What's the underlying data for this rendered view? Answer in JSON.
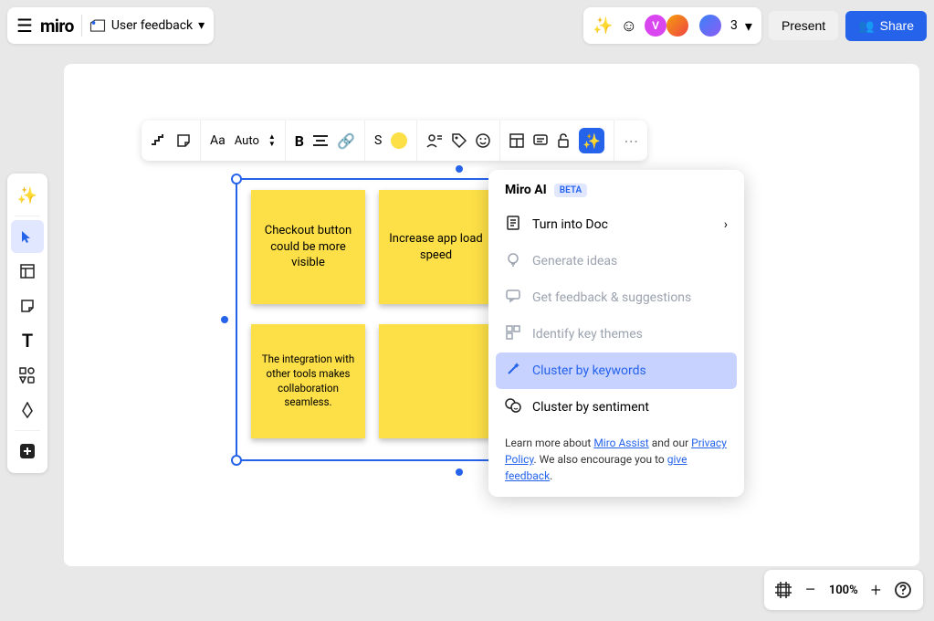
{
  "header": {
    "logo": "miro",
    "board_name": "User feedback",
    "user_count": "3",
    "present_label": "Present",
    "share_label": "Share",
    "avatar_letter": "V"
  },
  "context_toolbar": {
    "auto_label": "Auto",
    "size_label": "S",
    "font_label": "Aa"
  },
  "stickies": [
    {
      "text": "Checkout button could be more visible"
    },
    {
      "text": "Increase app load speed"
    },
    {
      "text": "The integration with other tools makes collaboration seamless."
    },
    {
      "text": ""
    }
  ],
  "ai_menu": {
    "title": "Miro AI",
    "badge": "BETA",
    "items": [
      {
        "icon": "doc",
        "label": "Turn into Doc",
        "has_submenu": true,
        "disabled": false
      },
      {
        "icon": "bulb",
        "label": "Generate ideas",
        "disabled": true
      },
      {
        "icon": "feedback",
        "label": "Get feedback & suggestions",
        "disabled": true
      },
      {
        "icon": "themes",
        "label": "Identify key themes",
        "disabled": true
      },
      {
        "icon": "wand",
        "label": "Cluster by keywords",
        "highlighted": true
      },
      {
        "icon": "sentiment",
        "label": "Cluster by sentiment"
      }
    ],
    "footer_pre": "Learn more about ",
    "footer_link1": "Miro Assist",
    "footer_mid": " and our ",
    "footer_link2": "Privacy Policy",
    "footer_post1": ". We also encourage you to ",
    "footer_link3": "give feedback",
    "footer_post2": "."
  },
  "zoom": {
    "level": "100%"
  }
}
